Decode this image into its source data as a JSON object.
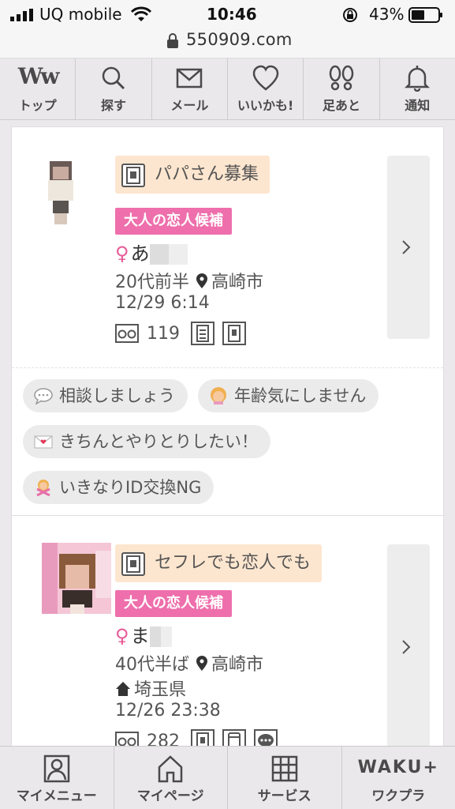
{
  "status_bar": {
    "carrier": "UQ mobile",
    "time": "10:46",
    "battery": "43%"
  },
  "url_bar": {
    "url": "550909.com"
  },
  "top_nav": {
    "logo": "Ww",
    "items": [
      {
        "label": "トップ",
        "icon": "logo-icon"
      },
      {
        "label": "探す",
        "icon": "search-icon"
      },
      {
        "label": "メール",
        "icon": "mail-icon"
      },
      {
        "label": "いいかも!",
        "icon": "heart-icon"
      },
      {
        "label": "足あと",
        "icon": "footprint-icon"
      },
      {
        "label": "通知",
        "icon": "bell-icon"
      }
    ]
  },
  "posts": [
    {
      "category": "パパさん募集",
      "tag": "大人の恋人候補",
      "gender_symbol": "♀",
      "name": "あ",
      "age": "20代前半",
      "city": "高崎市",
      "datetime": "12/29 6:14",
      "views": "119",
      "chips": [
        {
          "text": "相談しましょう",
          "emoji": "speech-bubble-emoji"
        },
        {
          "text": "年齢気にしません",
          "emoji": "woman-emoji"
        },
        {
          "text": "きちんとやりとりしたい！",
          "emoji": "love-letter-emoji"
        },
        {
          "text": "いきなりID交換NG",
          "emoji": "no-gesture-woman-emoji"
        }
      ]
    },
    {
      "category": "セフレでも恋人でも",
      "tag": "大人の恋人候補",
      "gender_symbol": "♀",
      "name": "ま",
      "age": "40代半ば",
      "city": "高崎市",
      "home": "埼玉県",
      "datetime": "12/26 23:38",
      "views": "282"
    }
  ],
  "bottom_nav": {
    "items": [
      {
        "label": "マイメニュー",
        "icon": "profile-icon"
      },
      {
        "label": "マイページ",
        "icon": "home-icon"
      },
      {
        "label": "サービス",
        "icon": "grid-icon"
      },
      {
        "label": "ワクプラ",
        "icon": "waku-plus-logo",
        "logo": "WAKU+"
      }
    ]
  },
  "colors": {
    "accent_pink": "#ee6fac",
    "category_bg": "#fde6cf",
    "nav_bg": "#ebe8eb"
  }
}
